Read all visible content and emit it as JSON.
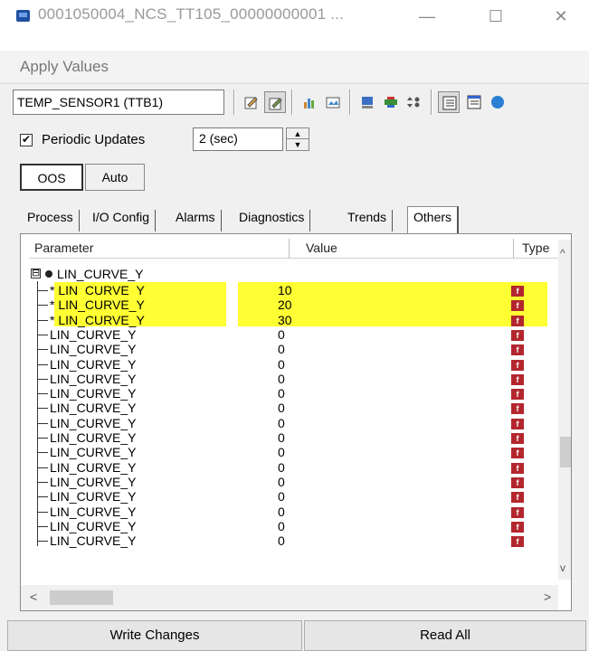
{
  "window": {
    "title": "0001050004_NCS_TT105_00000000001 ...",
    "minimize": "—",
    "maximize": "☐",
    "close": "✕"
  },
  "menu": {
    "items": [
      "Apply Values"
    ]
  },
  "toolbar": {
    "device": "TEMP_SENSOR1 (TTB1)",
    "icons": [
      "edit-icon",
      "edit-selected-icon",
      "chart-icon",
      "image-icon",
      "download-icon",
      "transfer-icon",
      "sort-icon",
      "list-view-icon",
      "detail-view-icon",
      "info-icon"
    ]
  },
  "periodic": {
    "label": "Periodic Updates",
    "checked": true,
    "check_mark": "✔",
    "interval": "2 (sec)"
  },
  "modes": {
    "oos": "OOS",
    "auto": "Auto"
  },
  "tabs": [
    "Process",
    "I/O Config",
    "Alarms",
    "Diagnostics",
    "Trends",
    "Others"
  ],
  "active_tab": "Others",
  "grid": {
    "columns": {
      "parameter": "Parameter",
      "value": "Value",
      "type": "Type"
    },
    "group": {
      "expander": "⊟",
      "name": "LIN_CURVE_Y"
    },
    "rows": [
      {
        "marker": "*",
        "name": "LIN_CURVE_Y",
        "value": "10",
        "changed": true
      },
      {
        "marker": "*",
        "name": "LIN_CURVE_Y",
        "value": "20",
        "changed": true
      },
      {
        "marker": "*",
        "name": "LIN_CURVE_Y",
        "value": "30",
        "changed": true
      },
      {
        "marker": "",
        "name": "LIN_CURVE_Y",
        "value": "0",
        "changed": false
      },
      {
        "marker": "",
        "name": "LIN_CURVE_Y",
        "value": "0",
        "changed": false
      },
      {
        "marker": "",
        "name": "LIN_CURVE_Y",
        "value": "0",
        "changed": false
      },
      {
        "marker": "",
        "name": "LIN_CURVE_Y",
        "value": "0",
        "changed": false
      },
      {
        "marker": "",
        "name": "LIN_CURVE_Y",
        "value": "0",
        "changed": false
      },
      {
        "marker": "",
        "name": "LIN_CURVE_Y",
        "value": "0",
        "changed": false
      },
      {
        "marker": "",
        "name": "LIN_CURVE_Y",
        "value": "0",
        "changed": false
      },
      {
        "marker": "",
        "name": "LIN_CURVE_Y",
        "value": "0",
        "changed": false
      },
      {
        "marker": "",
        "name": "LIN_CURVE_Y",
        "value": "0",
        "changed": false
      },
      {
        "marker": "",
        "name": "LIN_CURVE_Y",
        "value": "0",
        "changed": false
      },
      {
        "marker": "",
        "name": "LIN_CURVE_Y",
        "value": "0",
        "changed": false
      },
      {
        "marker": "",
        "name": "LIN_CURVE_Y",
        "value": "0",
        "changed": false
      },
      {
        "marker": "",
        "name": "LIN_CURVE_Y",
        "value": "0",
        "changed": false
      },
      {
        "marker": "",
        "name": "LIN_CURVE_Y",
        "value": "0",
        "changed": false
      },
      {
        "marker": "",
        "name": "LIN_CURVE_Y",
        "value": "0",
        "changed": false
      }
    ],
    "type_icon": "f",
    "scroll_up": "^",
    "scroll_down": "v",
    "scroll_left": "<",
    "scroll_right": ">"
  },
  "colors": {
    "changed_row": "#ffff33",
    "type_icon": "#b3262e"
  },
  "footer": {
    "write": "Write Changes",
    "read": "Read All"
  }
}
